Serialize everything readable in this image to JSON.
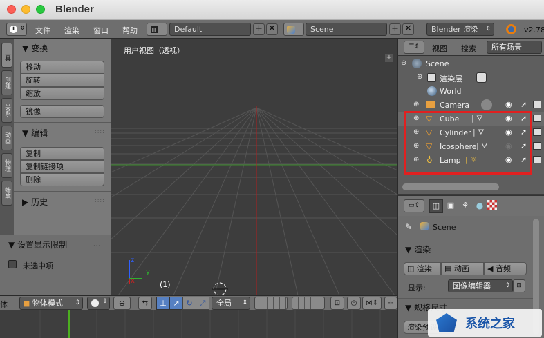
{
  "window": {
    "title": "Blender"
  },
  "menubar": {
    "items": [
      "文件",
      "渲染",
      "窗口",
      "帮助"
    ],
    "screen_layout": "Default",
    "scene": "Scene",
    "render_engine": "Blender 渲染",
    "version": "v2.78"
  },
  "side_tabs": [
    "工具",
    "创建",
    "关系",
    "动画",
    "物理",
    "蜡笔"
  ],
  "tool_panel": {
    "transform_header": "变换",
    "transform_buttons": [
      "移动",
      "旋转",
      "缩放"
    ],
    "mirror_button": "镜像",
    "edit_header": "编辑",
    "edit_buttons": [
      "复制",
      "复制链接项",
      "删除"
    ],
    "history_header": "历史"
  },
  "redo_panel": {
    "header": "设置显示限制",
    "checkbox_label": "未选中项"
  },
  "viewport": {
    "label": "用户视图（透视）",
    "frame": "(1)",
    "axis_x": "x",
    "axis_y": "y",
    "axis_z": "z",
    "corner_plus": "+"
  },
  "view3d_header": {
    "cut_label": "体",
    "mode": "物体模式",
    "orientation": "全局"
  },
  "outliner": {
    "tab_view": "视图",
    "tab_search": "搜索",
    "filter": "所有场景",
    "scene": "Scene",
    "render_layers": "渲染层",
    "world": "World",
    "objects": [
      "Camera",
      "Cube",
      "Cylinder",
      "Icosphere",
      "Lamp"
    ],
    "highlight_color": "#e02020"
  },
  "properties": {
    "scene": "Scene",
    "render_header": "渲染",
    "render_buttons": [
      "渲染",
      "动画",
      "音频"
    ],
    "display_label": "显示:",
    "display_value": "图像编辑器",
    "dimensions_header": "规格尺寸",
    "render_preset": "渲染预设"
  },
  "watermark": {
    "text": "系统之家"
  },
  "colors": {
    "grid_red": "#b02020",
    "grid_green": "#3a8a2a",
    "timeline_frame": "#4caf20"
  }
}
